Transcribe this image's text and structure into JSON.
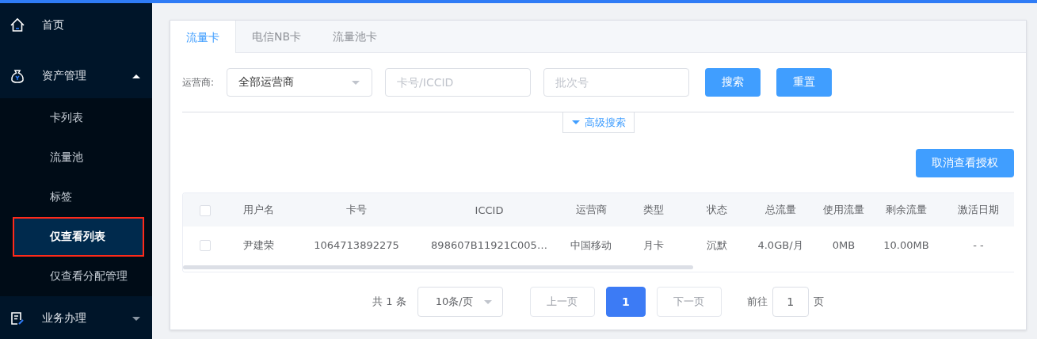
{
  "sidebar": {
    "items": [
      {
        "label": "首页",
        "kind": "home"
      },
      {
        "label": "资产管理",
        "kind": "asset",
        "expanded": true,
        "children": [
          {
            "label": "卡列表",
            "selected": false
          },
          {
            "label": "流量池",
            "selected": false
          },
          {
            "label": "标签",
            "selected": false
          },
          {
            "label": "仅查看列表",
            "selected": true
          },
          {
            "label": "仅查看分配管理",
            "selected": false
          }
        ]
      },
      {
        "label": "业务办理",
        "kind": "business",
        "expanded": false
      }
    ]
  },
  "tabs": [
    {
      "label": "流量卡",
      "selected": true
    },
    {
      "label": "电信NB卡",
      "selected": false
    },
    {
      "label": "流量池卡",
      "selected": false
    }
  ],
  "filters": {
    "operator_label": "运营商:",
    "operator_value": "全部运营商",
    "card_placeholder": "卡号/ICCID",
    "batch_placeholder": "批次号"
  },
  "buttons": [
    "搜索",
    "重置"
  ],
  "advanced_search": "高级搜索",
  "revoke_button": "取消查看授权",
  "table": {
    "header_checked": false,
    "columns": [
      "用户名",
      "卡号",
      "ICCID",
      "运营商",
      "类型",
      "状态",
      "总流量",
      "使用流量",
      "剩余流量",
      "激活日期"
    ],
    "rows": [
      {
        "checked": false,
        "cells": [
          "尹建荣",
          "1064713892275",
          "898607B11921C005…",
          "中国移动",
          "月卡",
          "沉默",
          "4.0GB/月",
          "0MB",
          "10.00MB",
          "- -"
        ]
      }
    ]
  },
  "pagination": {
    "total": "共 1 条",
    "page_size": "10条/页",
    "prev": {
      "label": "上一页",
      "disabled": true
    },
    "pages": [
      {
        "label": "1",
        "selected": true
      }
    ],
    "next": {
      "label": "下一页",
      "disabled": true
    },
    "goto_label": "前往",
    "goto_value": "1",
    "page_suffix": "页"
  }
}
